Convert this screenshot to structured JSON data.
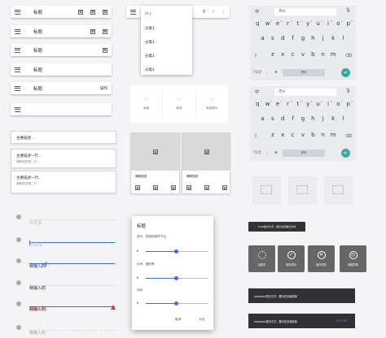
{
  "colors": {
    "accent": "#3a6fd8",
    "error": "#d0433a",
    "teal": "#3aaaa0"
  },
  "appbars": {
    "title": "标题",
    "action": "操作"
  },
  "menu": {
    "items": [
      "ALL",
      "分类1",
      "分类1",
      "分类1",
      "分类1"
    ]
  },
  "tabs": {
    "number": "15",
    "labels": [
      "私信",
      "私信",
      "私信提示"
    ]
  },
  "keyboard": {
    "lang_cn": "中",
    "lang_en": "En",
    "row1": [
      "q",
      "w",
      "e",
      "r",
      "t",
      "y",
      "u",
      "i",
      "o",
      "p"
    ],
    "row1_sub": [
      "1",
      "2",
      "3",
      "4",
      "5",
      "6",
      "7",
      "8",
      "9",
      "0"
    ],
    "row2": [
      "a",
      "s",
      "d",
      "f",
      "g",
      "h",
      "j",
      "k",
      "l"
    ],
    "row3": [
      "z",
      "x",
      "c",
      "v",
      "b",
      "n",
      "m"
    ],
    "numkey": "?1☺",
    "comma": ",",
    "space": "拼写",
    "period": "."
  },
  "lists": [
    {
      "primary": "主要描述...",
      "secondary": ""
    },
    {
      "primary": "主要描述一行...",
      "secondary": "辅助描述第二行..."
    },
    {
      "primary": "主要描述一行...",
      "secondary": "辅助描述第二行..."
    }
  ],
  "image_cards": [
    {
      "caption": "辅助描述"
    },
    {
      "caption": "辅助描述"
    }
  ],
  "fields": [
    {
      "value": "引导语",
      "state": "placeholder"
    },
    {
      "value": "引导语",
      "state": "focused"
    },
    {
      "value": "我输入的",
      "state": "filled"
    },
    {
      "value": "我输入的",
      "state": "filled"
    },
    {
      "value": "我输入的",
      "state": "error",
      "helper": "错误提示文字"
    },
    {
      "value": "我输入的",
      "state": "disabled"
    }
  ],
  "dialog": {
    "title": "标题",
    "subtitle": "音乐、视频和媒体节目",
    "section2": "铃声、通知等",
    "section3": "闹钟",
    "sliders": [
      0.48,
      0.48,
      0.48
    ],
    "cancel": "取消",
    "ok": "完成"
  },
  "toast": {
    "text": "toast提示文字，展示在页面正中间"
  },
  "status_tiles": [
    {
      "label": "加载中",
      "icon": "spinner-icon"
    },
    {
      "label": "操作成功",
      "icon": "check-icon"
    },
    {
      "label": "操作失败",
      "icon": "cross-icon"
    },
    {
      "label": "网络异常",
      "icon": "sad-face-icon"
    }
  ],
  "snackbars": [
    {
      "text": "snackbar提示文字，展示在页面底部",
      "action": ""
    },
    {
      "text": "snackbar提示文字，展示在页面底部",
      "action": "ACTION"
    }
  ]
}
